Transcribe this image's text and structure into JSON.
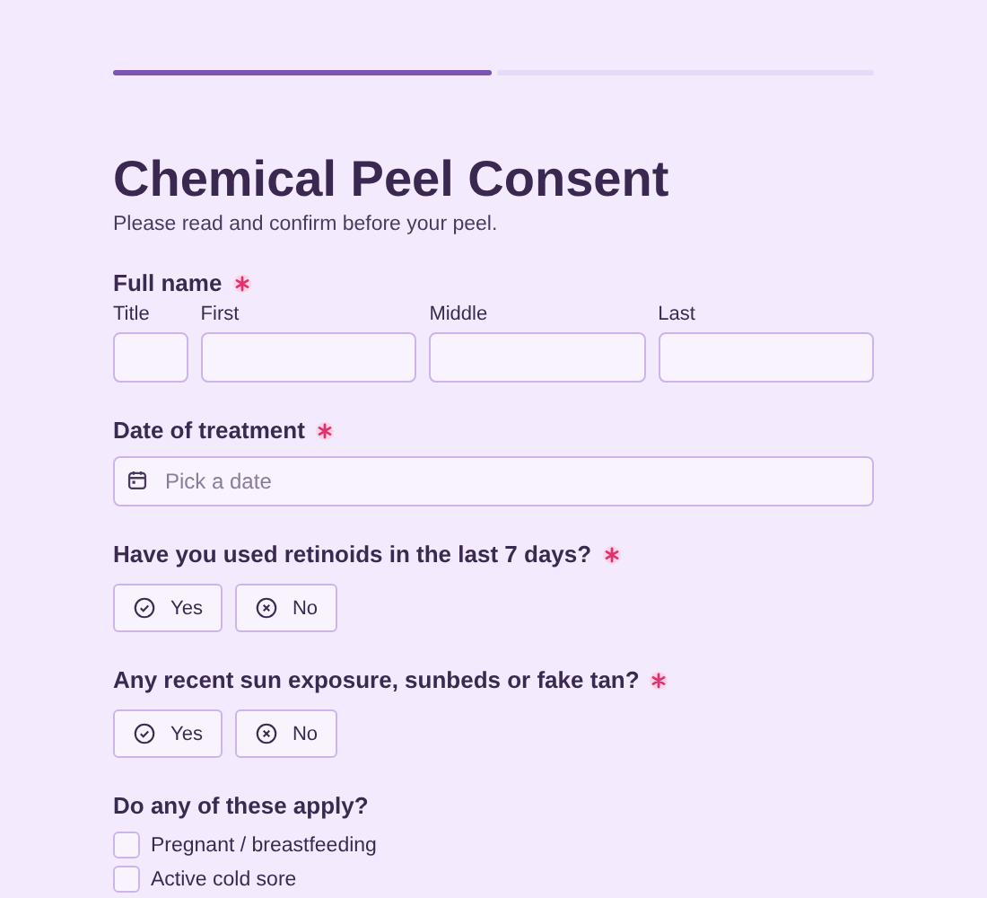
{
  "progress": {
    "steps": [
      {
        "complete": true
      },
      {
        "complete": false
      }
    ]
  },
  "title": "Chemical Peel Consent",
  "subtitle": "Please read and confirm before your peel.",
  "fields": [
    {
      "kind": "name",
      "label": "Full name",
      "required": true,
      "parts": [
        {
          "label": "Title"
        },
        {
          "label": "First"
        },
        {
          "label": "Middle"
        },
        {
          "label": "Last"
        }
      ]
    },
    {
      "kind": "date",
      "label": "Date of treatment",
      "required": true,
      "placeholder": "Pick a date"
    },
    {
      "kind": "choice",
      "label": "Have you used retinoids in the last 7 days?",
      "required": true,
      "options": [
        {
          "kind": "yes",
          "label": "Yes",
          "selected": false
        },
        {
          "kind": "no",
          "label": "No",
          "selected": false
        }
      ]
    },
    {
      "kind": "choice",
      "label": "Any recent sun exposure, sunbeds or fake tan?",
      "required": true,
      "options": [
        {
          "kind": "yes",
          "label": "Yes",
          "selected": false
        },
        {
          "kind": "no",
          "label": "No",
          "selected": false
        }
      ]
    },
    {
      "kind": "checklist",
      "label": "Do any of these apply?",
      "required": false,
      "items": [
        {
          "label": "Pregnant / breastfeeding",
          "checked": false
        },
        {
          "label": "Active cold sore",
          "checked": false
        }
      ]
    }
  ]
}
